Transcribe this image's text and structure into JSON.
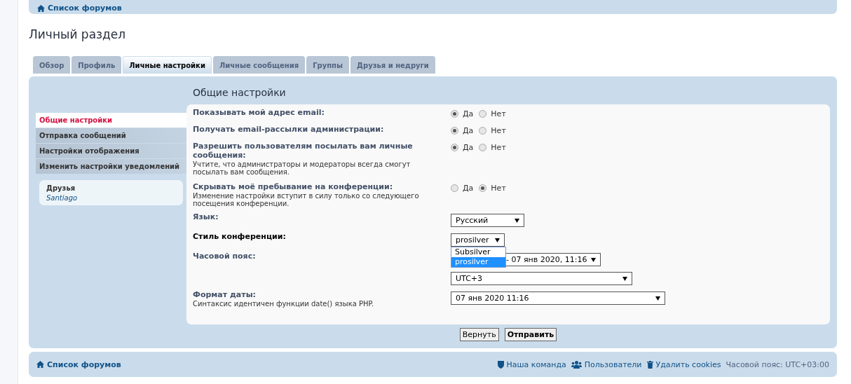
{
  "top_nav": {
    "home_label": "Список форумов"
  },
  "page_title": "Личный раздел",
  "tabs": [
    {
      "label": "Обзор",
      "selected": false
    },
    {
      "label": "Профиль",
      "selected": false
    },
    {
      "label": "Личные настройки",
      "selected": true
    },
    {
      "label": "Личные сообщения",
      "selected": false
    },
    {
      "label": "Группы",
      "selected": false
    },
    {
      "label": "Друзья и недруги",
      "selected": false
    }
  ],
  "sidebar": {
    "items": [
      {
        "label": "Общие настройки",
        "selected": true
      },
      {
        "label": "Отправка сообщений",
        "selected": false
      },
      {
        "label": "Настройки отображения",
        "selected": false
      },
      {
        "label": "Изменить настройки уведомлений",
        "selected": false
      }
    ],
    "friends": {
      "title": "Друзья",
      "names": [
        "Santiago"
      ]
    }
  },
  "section_title": "Общие настройки",
  "settings": [
    {
      "kind": "radio",
      "label": "Показывать мой адрес email:",
      "highlighted": false,
      "options": [
        {
          "label": "Да",
          "selected": true
        },
        {
          "label": "Нет",
          "selected": false
        }
      ]
    },
    {
      "kind": "radio",
      "label": "Получать email-рассылки администрации:",
      "highlighted": false,
      "options": [
        {
          "label": "Да",
          "selected": true
        },
        {
          "label": "Нет",
          "selected": false
        }
      ]
    },
    {
      "kind": "radio",
      "label": "Разрешить пользователям посылать вам личные сообщения:",
      "explanation": "Учтите, что администраторы и модераторы всегда смогут посылать вам сообщения.",
      "highlighted": false,
      "options": [
        {
          "label": "Да",
          "selected": true
        },
        {
          "label": "Нет",
          "selected": false
        }
      ]
    },
    {
      "kind": "radio",
      "label": "Скрывать моё пребывание на конференции:",
      "explanation": "Изменение настройки вступит в силу только со следующего посещения конференции.",
      "highlighted": false,
      "options": [
        {
          "label": "Да",
          "selected": false
        },
        {
          "label": "Нет",
          "selected": true
        }
      ]
    },
    {
      "kind": "select",
      "label": "Язык:",
      "highlighted": false,
      "values": [
        "Русский"
      ]
    },
    {
      "kind": "select",
      "label": "Стиль конференции:",
      "highlighted": true,
      "values": [
        "prosilver"
      ],
      "expanded": true,
      "options": [
        {
          "label": "Subsilver",
          "selected": false
        },
        {
          "label": "prosilver",
          "selected": true
        }
      ]
    },
    {
      "kind": "select",
      "label": "Часовой пояс:",
      "highlighted": false,
      "values": [
        "- 07 янв 2020, 11:16",
        "UTC+3"
      ]
    },
    {
      "kind": "select",
      "label": "Формат даты:",
      "explanation": "Синтаксис идентичен функции date() языка PHP.",
      "highlighted": false,
      "values": [
        "07 янв 2020 11:16"
      ]
    }
  ],
  "buttons": [
    {
      "label": "Вернуть",
      "primary": false
    },
    {
      "label": "Отправить",
      "primary": true
    }
  ],
  "footer": {
    "home_label": "Список форумов",
    "links": [
      {
        "kind": "shield",
        "label": "Наша команда"
      },
      {
        "kind": "users",
        "label": "Пользователи"
      },
      {
        "kind": "trash",
        "label": "Удалить cookies"
      }
    ],
    "timezone": "Часовой пояс: UTC+03:00"
  }
}
